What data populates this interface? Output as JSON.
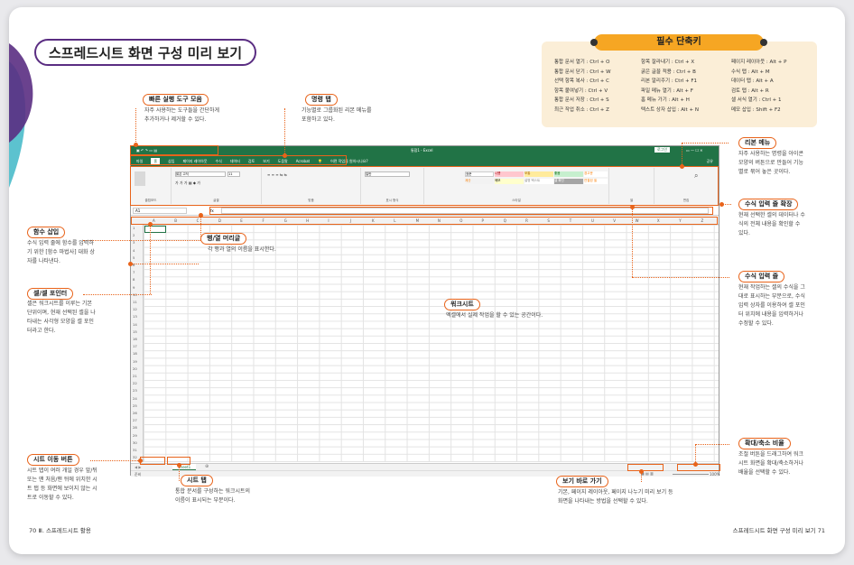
{
  "page_title": "스프레드시트 화면 구성 미리 보기",
  "shortcuts": {
    "title": "필수 단축키",
    "col1": [
      "통합 문서 열기 : Ctrl + O",
      "통합 문서 닫기 : Ctrl + W",
      "선택 항목 복사 : Ctrl + C",
      "항목 붙여넣기 : Ctrl + V",
      "통합 문서 저장 : Ctrl + S",
      "최근 작업 취소 : Ctrl + Z"
    ],
    "col2": [
      "항목 잘라내기 : Ctrl + X",
      "굵은 글꼴 적용 : Ctrl + B",
      "리본 알리주기 : Ctrl + F1",
      "파일 메뉴 열기 : Alt + F",
      "홈 메뉴 가기 : Alt + H",
      "텍스트 상자 삽입 : Alt + N"
    ],
    "col3": [
      "페이지 레이아웃 : Alt + P",
      "수식 탭 : Alt + M",
      "데이터 탭 : Alt + A",
      "검토 탭 : Alt + R",
      "셀 서식 열기 : Ctrl + 1",
      "메모 삽입 : Shift + F2"
    ]
  },
  "callouts": {
    "qat": {
      "label": "빠른 실행 도구 모음",
      "desc": [
        "자주 사용하는 도구들을 간단하게",
        "추가하거나 제거할 수 있다."
      ]
    },
    "tabs": {
      "label": "명령 탭",
      "desc": [
        "기능별로 그룹화된 리본 메뉴를",
        "포함하고 있다."
      ]
    },
    "ribbon": {
      "label": "리본 메뉴",
      "desc": [
        "자주 사용하는 명령을 아이콘",
        "모양의 버튼으로 만들어 기능",
        "별로 묶어 놓은 곳이다."
      ]
    },
    "expand": {
      "label": "수식 입력 줄 확장",
      "desc": [
        "현재 선택한 셀의 데이터나 수",
        "식의 전체 내용을 확인할 수",
        "있다."
      ]
    },
    "fx": {
      "label": "함수 삽입",
      "desc": [
        "수식 입력 줄에 함수를 입력하",
        "기 위한 [함수 마법사] 대화 상",
        "자를 나타낸다."
      ]
    },
    "header": {
      "label": "행/열 머리글",
      "desc": [
        "각 행과 열의 이름을 표시한다."
      ]
    },
    "cell": {
      "label": "셀/셀 포인터",
      "desc": [
        "셀은 워크시트를 이루는 기본",
        "단위이며, 현재 선택된 셀을 나",
        "타내는 사각형 모양을 셀 포인",
        "터라고 한다."
      ]
    },
    "worksheet": {
      "label": "워크시트",
      "desc": [
        "엑셀에서 실제 작업을 할 수 있는 공간이다."
      ]
    },
    "formula": {
      "label": "수식 입력 줄",
      "desc": [
        "현재 작업하는 셀의 수식을 그",
        "대로 표시하는 부분으로, 수식",
        "입력 상자를 이용하여 셀 포인",
        "터 위치에 내용을 입력하거나",
        "수정할 수 있다."
      ]
    },
    "zoom": {
      "label": "확대/축소 비율",
      "desc": [
        "조절 버튼을 드래그하여 워크",
        "시트 화면을 확대/축소하거나",
        "배율을 선택할 수 있다."
      ]
    },
    "sheetnav": {
      "label": "시트 이동 버튼",
      "desc": [
        "시트 탭이 여러 개일 경우 앞/뒤",
        "또는 맨 처음/맨 뒤에 위치한 시",
        "트 탭 등 화면에 보이지 않는 시",
        "트로 이동할 수 있다."
      ]
    },
    "sheettab": {
      "label": "시트 탭",
      "desc": [
        "통합 문서를 구성하는 워크시트의",
        "이름이 표시되는 부분이다."
      ]
    },
    "views": {
      "label": "보기 바로 가기",
      "desc": [
        "기본, 페이지 레이아웃, 페이지 나누기 미리 보기 등",
        "화면을 나타내는 방법을 선택할 수 있다."
      ]
    }
  },
  "excel": {
    "title": "통합1 - Excel",
    "login": "로그인",
    "share": "공유",
    "tabs": [
      "파일",
      "홈",
      "삽입",
      "페이지 레이아웃",
      "수식",
      "데이터",
      "검토",
      "보기",
      "도움말",
      "Acrobat"
    ],
    "tell_me": "어떤 작업을 원하시나요?",
    "namebox": "A1",
    "groups": [
      "클립보드",
      "글꼴",
      "맞춤",
      "표시 형식",
      "스타일",
      "셀",
      "편집"
    ],
    "font": "맑은 고딕",
    "font_size": "11",
    "num_format": "일반",
    "styles": [
      "표준",
      "나쁨",
      "보통",
      "좋음",
      "경고문",
      "계산",
      "메모",
      "설명 텍스트",
      "셀 확인",
      "연결된 셀"
    ],
    "columns": [
      "A",
      "B",
      "C",
      "D",
      "E",
      "F",
      "G",
      "H",
      "I",
      "J",
      "K",
      "L",
      "M",
      "N",
      "O",
      "P",
      "Q",
      "R",
      "S",
      "T",
      "U",
      "V",
      "W",
      "X",
      "Y",
      "Z"
    ],
    "rows": [
      "1",
      "2",
      "3",
      "4",
      "5",
      "6",
      "7",
      "8",
      "9",
      "10",
      "11",
      "12",
      "13",
      "14",
      "15",
      "16",
      "17",
      "18",
      "19",
      "20",
      "21",
      "22",
      "23",
      "24",
      "25",
      "26",
      "27",
      "28",
      "29",
      "30",
      "31",
      "32"
    ],
    "sheet_tab": "Sheet1",
    "status": "준비",
    "zoom": "100%"
  },
  "footer": {
    "left": "70  Ⅲ. 스프레드시트 활용",
    "right": "스프레드시트 화면 구성 미리 보기  71"
  }
}
